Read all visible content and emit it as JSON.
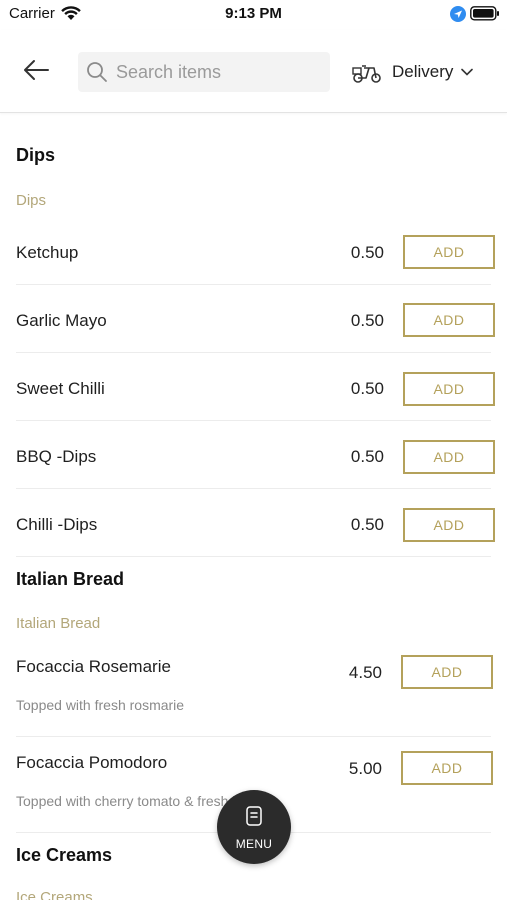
{
  "status_bar": {
    "carrier": "Carrier",
    "time": "9:13 PM"
  },
  "header": {
    "search_placeholder": "Search items",
    "delivery_label": "Delivery",
    "icons": [
      "back-arrow-icon",
      "search-icon",
      "scooter-icon",
      "chevron-down-icon"
    ]
  },
  "sections": [
    {
      "title": "Dips",
      "subtitle": "Dips",
      "items": [
        {
          "name": "Ketchup",
          "price": "0.50",
          "action": "ADD"
        },
        {
          "name": "Garlic Mayo",
          "price": "0.50",
          "action": "ADD"
        },
        {
          "name": "Sweet Chilli",
          "price": "0.50",
          "action": "ADD"
        },
        {
          "name": "BBQ -Dips",
          "price": "0.50",
          "action": "ADD"
        },
        {
          "name": "Chilli -Dips",
          "price": "0.50",
          "action": "ADD"
        }
      ]
    },
    {
      "title": "Italian Bread",
      "subtitle": "Italian Bread",
      "items": [
        {
          "name": "Focaccia Rosemarie",
          "price": "4.50",
          "action": "ADD",
          "description": "Topped with fresh rosmarie"
        },
        {
          "name": "Focaccia Pomodoro",
          "price": "5.00",
          "action": "ADD",
          "description": "Topped with cherry tomato & fresh basil"
        }
      ]
    },
    {
      "title": "Ice Creams",
      "subtitle": "Ice Creams",
      "items": []
    }
  ],
  "fab": {
    "label": "MENU"
  },
  "colors": {
    "accent": "#b4a15b",
    "subtitle": "#b3a77a",
    "fab": "#2b2b2b"
  }
}
